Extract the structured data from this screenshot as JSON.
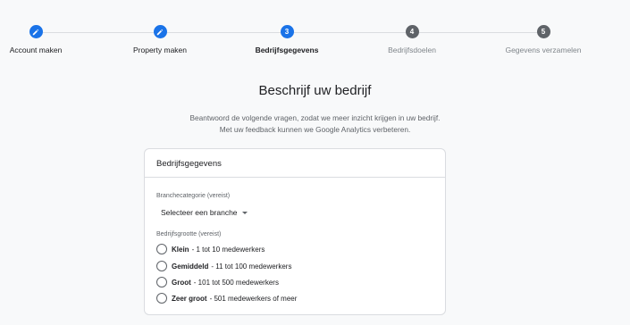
{
  "stepper": {
    "steps": [
      {
        "number": "",
        "label": "Account maken",
        "state": "done",
        "icon": "pencil-icon"
      },
      {
        "number": "",
        "label": "Property maken",
        "state": "done",
        "icon": "pencil-icon"
      },
      {
        "number": "3",
        "label": "Bedrijfsgegevens",
        "state": "active"
      },
      {
        "number": "4",
        "label": "Bedrijfsdoelen",
        "state": "todo"
      },
      {
        "number": "5",
        "label": "Gegevens verzamelen",
        "state": "todo"
      }
    ]
  },
  "main": {
    "title": "Beschrijf uw bedrijf",
    "description_line1": "Beantwoord de volgende vragen, zodat we meer inzicht krijgen in uw bedrijf.",
    "description_line2": "Met uw feedback kunnen we Google Analytics verbeteren."
  },
  "card": {
    "header": "Bedrijfsgegevens",
    "category_label": "Branchecategorie (vereist)",
    "category_select_value": "Selecteer een branche",
    "size_label": "Bedrijfsgrootte (vereist)",
    "size_options": [
      {
        "bold": "Klein",
        "rest": "- 1 tot 10 medewerkers"
      },
      {
        "bold": "Gemiddeld",
        "rest": "- 11 tot 100 medewerkers"
      },
      {
        "bold": "Groot",
        "rest": "- 101 tot 500 medewerkers"
      },
      {
        "bold": "Zeer groot",
        "rest": "- 501 medewerkers of meer"
      }
    ]
  },
  "colors": {
    "accent": "#1a73e8",
    "pending": "#5f6368",
    "background": "#f8f9fa"
  }
}
